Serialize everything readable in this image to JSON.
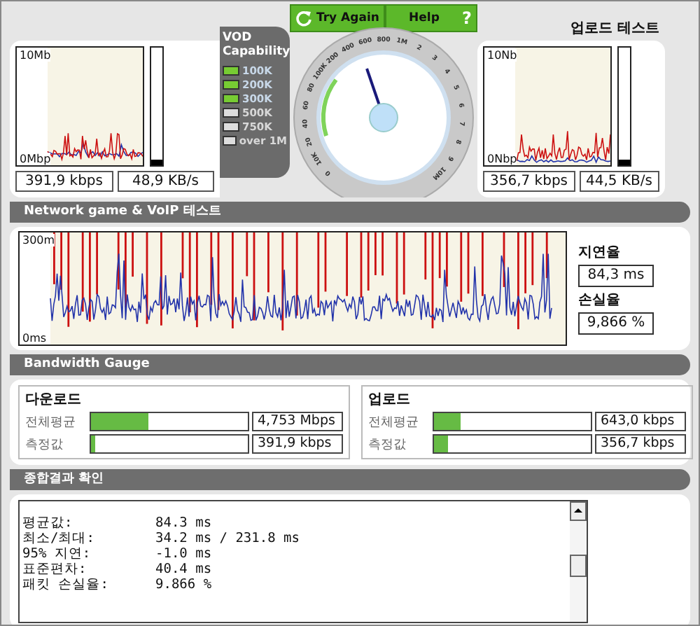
{
  "download_test": {
    "graph": {
      "y_top": "10Mb",
      "y_bottom": "0Mbp"
    },
    "meter": {
      "level": 0.05
    },
    "readings": [
      "391,9 kbps",
      "48,9 KB/s"
    ]
  },
  "vod_capability": {
    "title": "VOD Capability",
    "items": [
      {
        "label": "100K",
        "on": true
      },
      {
        "label": "200K",
        "on": true
      },
      {
        "label": "300K",
        "on": true
      },
      {
        "label": "500K",
        "on": false
      },
      {
        "label": "750K",
        "on": false
      },
      {
        "label": "over 1M",
        "on": false
      }
    ]
  },
  "dial": {
    "buttons": [
      {
        "label": "Try Again",
        "kind": "refresh"
      },
      {
        "label": "Help",
        "kind": "help",
        "icon_text": "?"
      }
    ],
    "scale_labels": [
      "0",
      "10K",
      "20",
      "40",
      "60",
      "80",
      "100K",
      "200",
      "400",
      "600",
      "800",
      "1M",
      "2",
      "3",
      "4",
      "5",
      "6",
      "7",
      "8",
      "9",
      "10M"
    ],
    "level": 0.43
  },
  "upload_test": {
    "title": "업로드 테스트",
    "graph": {
      "y_top": "10Nb",
      "y_bottom": "0Nbp"
    },
    "meter": {
      "level": 0.05
    },
    "readings": [
      "356,7 kbps",
      "44,5 KB/s"
    ]
  },
  "voip_test": {
    "title": "Network game & VoIP 테스트",
    "graph": {
      "y_top": "300m",
      "y_bottom": "0ms"
    },
    "latency": {
      "label": "지연율",
      "value": "84,3 ms"
    },
    "loss": {
      "label": "손실율",
      "value": "9,866 %"
    }
  },
  "bandwidth_gauge": {
    "title": "Bandwidth Gauge",
    "groups": [
      {
        "title": "다운로드",
        "rows": [
          {
            "label": "전체평균",
            "level": 0.37,
            "value": "4,753 Mbps"
          },
          {
            "label": "측정값",
            "level": 0.03,
            "value": "391,9 kbps"
          }
        ]
      },
      {
        "title": "업로드",
        "rows": [
          {
            "label": "전체평균",
            "level": 0.17,
            "value": "643,0 kbps"
          },
          {
            "label": "측정값",
            "level": 0.09,
            "value": "356,7 kbps"
          }
        ]
      }
    ]
  },
  "summary": {
    "title": "종합결과 확인",
    "lines": [
      {
        "label": "평균값:",
        "value": "84.3 ms"
      },
      {
        "label": "최소/최대:",
        "value": "34.2 ms / 231.8 ms"
      },
      {
        "label": "95% 지연:",
        "value": "-1.0 ms"
      },
      {
        "label": "표준편차:",
        "value": "40.4 ms"
      },
      {
        "label": "패킷 손실율:",
        "value": "9.866 %"
      }
    ]
  }
}
